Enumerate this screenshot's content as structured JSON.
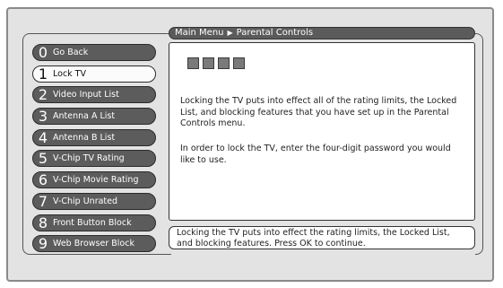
{
  "breadcrumb": {
    "parent": "Main Menu",
    "separator": "▶",
    "current": "Parental Controls"
  },
  "menu": {
    "items": [
      {
        "num": "0",
        "label": "Go Back"
      },
      {
        "num": "1",
        "label": "Lock TV"
      },
      {
        "num": "2",
        "label": "Video Input List"
      },
      {
        "num": "3",
        "label": "Antenna A List"
      },
      {
        "num": "4",
        "label": "Antenna B List"
      },
      {
        "num": "5",
        "label": "V-Chip TV Rating"
      },
      {
        "num": "6",
        "label": "V-Chip Movie Rating"
      },
      {
        "num": "7",
        "label": "V-Chip Unrated"
      },
      {
        "num": "8",
        "label": "Front Button Block"
      },
      {
        "num": "9",
        "label": "Web Browser Block"
      }
    ],
    "selected_index": 1
  },
  "content": {
    "password_boxes": 4,
    "paragraph1": "Locking the TV puts into effect all of the rating limits, the Locked List, and blocking features that you have set up in the Parental Controls menu.",
    "paragraph2": "In order to lock the TV, enter the four-digit password you would like to use."
  },
  "footer": {
    "text": "Locking the TV puts into effect the rating limits, the Locked List, and blocking features. Press OK to continue."
  },
  "colors": {
    "panel": "#e3e3e3",
    "menu_item": "#5c5c5c",
    "menu_item_selected": "#fbfbfb",
    "title_bar": "#5b5b5b"
  }
}
